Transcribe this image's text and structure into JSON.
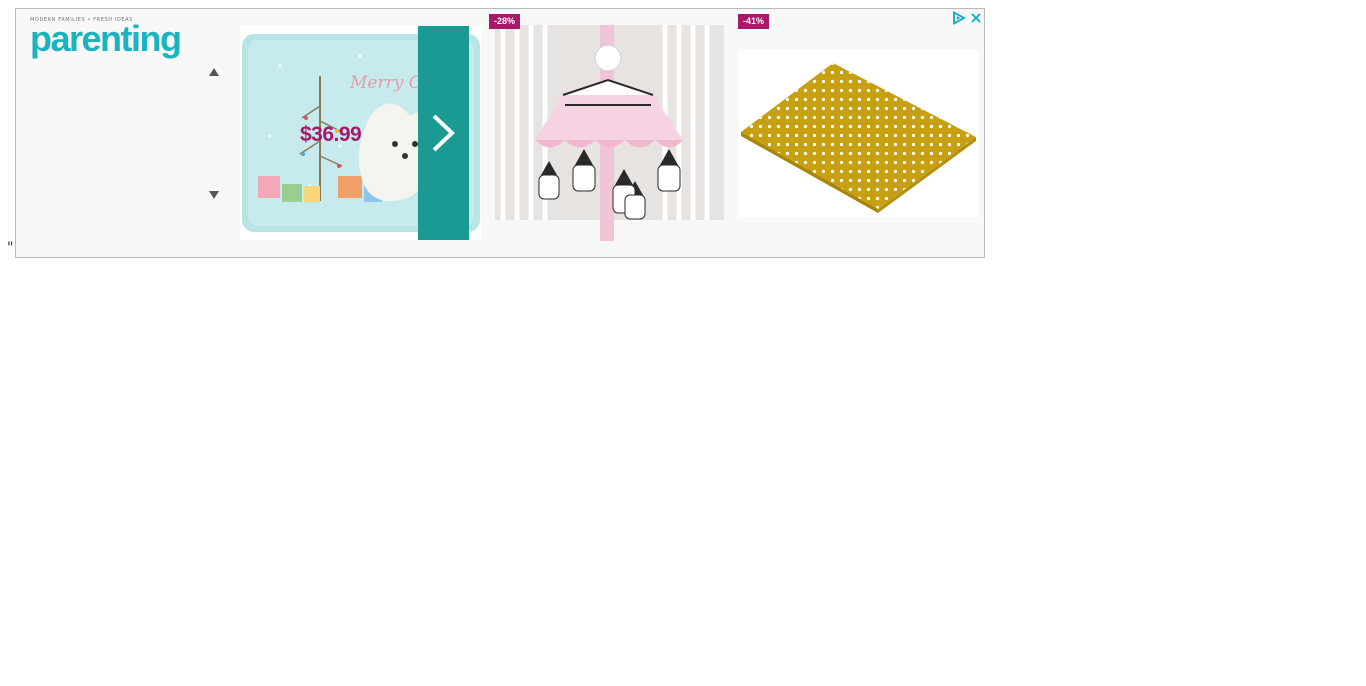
{
  "page": {
    "stray_text": "\""
  },
  "ad": {
    "brand_tagline": "Modern Families • Fresh Ideas",
    "brand_name": "parenting",
    "products": [
      {
        "price": "$36.99",
        "image_text": "Merry Ch"
      },
      {
        "discount": "-28%"
      },
      {
        "discount": "-41%"
      }
    ],
    "colors": {
      "brand": "#1ab4c1",
      "next_button": "#1a9a93",
      "badge": "#a8176a",
      "adchoices": "#00aecd"
    },
    "icons": {
      "up": "triangle-up-icon",
      "down": "triangle-down-icon",
      "next": "chevron-right-icon",
      "adchoices": "play-triangle-icon",
      "close": "close-icon"
    }
  }
}
